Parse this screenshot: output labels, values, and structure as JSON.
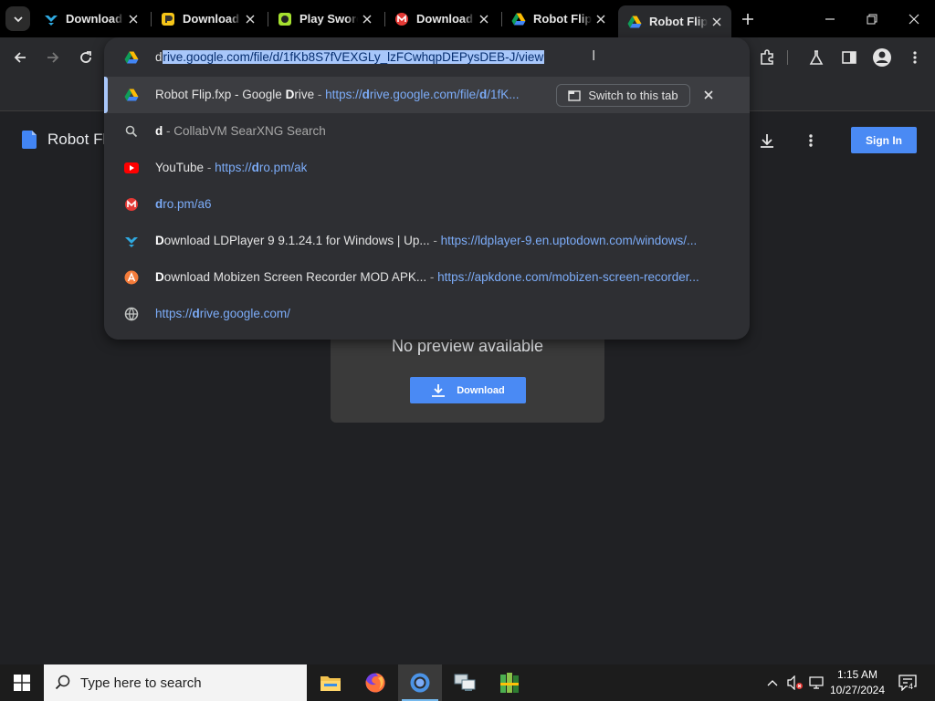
{
  "tabs": [
    {
      "title": "Download",
      "favicon": "uptodown-icon",
      "active": false
    },
    {
      "title": "Download",
      "favicon": "apkpure-icon",
      "active": false
    },
    {
      "title": "Play Sword",
      "favicon": "game-icon",
      "active": false
    },
    {
      "title": "Download",
      "favicon": "mobizen-icon",
      "active": false
    },
    {
      "title": "Robot Flip",
      "favicon": "google-drive-icon",
      "active": false
    },
    {
      "title": "Robot Flip",
      "favicon": "google-drive-icon",
      "active": true
    }
  ],
  "omnibox": {
    "typed": "d",
    "selected": "rive.google.com/file/d/1fKb8S7fVEXGLy_lzFCwhqpDEPysDEB-J/view"
  },
  "suggestions": [
    {
      "pre": "Robot Flip.fxp - Google ",
      "bold": "D",
      "post": "rive",
      "sep": " - ",
      "url_pre": "https://",
      "url_bold": "d",
      "url_mid": "rive.google.com/file/",
      "url_bold2": "d",
      "url_post": "/1fK...",
      "button": "Switch to this tab"
    },
    {
      "bold": "d",
      "dim": " - CollabVM SearXNG Search"
    },
    {
      "text": "YouTube",
      "sep": " - ",
      "url_pre": "https://",
      "url_bold": "d",
      "url_post": "ro.pm/ak"
    },
    {
      "url_bold": "d",
      "url_post": "ro.pm/a6"
    },
    {
      "bold": "D",
      "text": "ownload LDPlayer 9 9.1.24.1 for Windows | Up...",
      "sep": " - ",
      "url": "https://ldplayer-9.en.uptodown.com/windows/..."
    },
    {
      "bold": "D",
      "text": "ownload Mobizen Screen Recorder MOD APK...",
      "sep": " - ",
      "url": "https://apkdone.com/mobizen-screen-recorder..."
    },
    {
      "url_pre": "https://",
      "url_bold": "d",
      "url_post": "rive.google.com/"
    }
  ],
  "page": {
    "title": "Robot Fl",
    "signin": "Sign In",
    "no_preview": "No preview available",
    "download": "Download"
  },
  "taskbar": {
    "search_placeholder": "Type here to search",
    "time": "1:15 AM",
    "date": "10/27/2024",
    "notification_count": "4"
  },
  "colors": {
    "accent": "#4a8af4",
    "url": "#7cacf8",
    "selection": "#a8c7fa"
  }
}
